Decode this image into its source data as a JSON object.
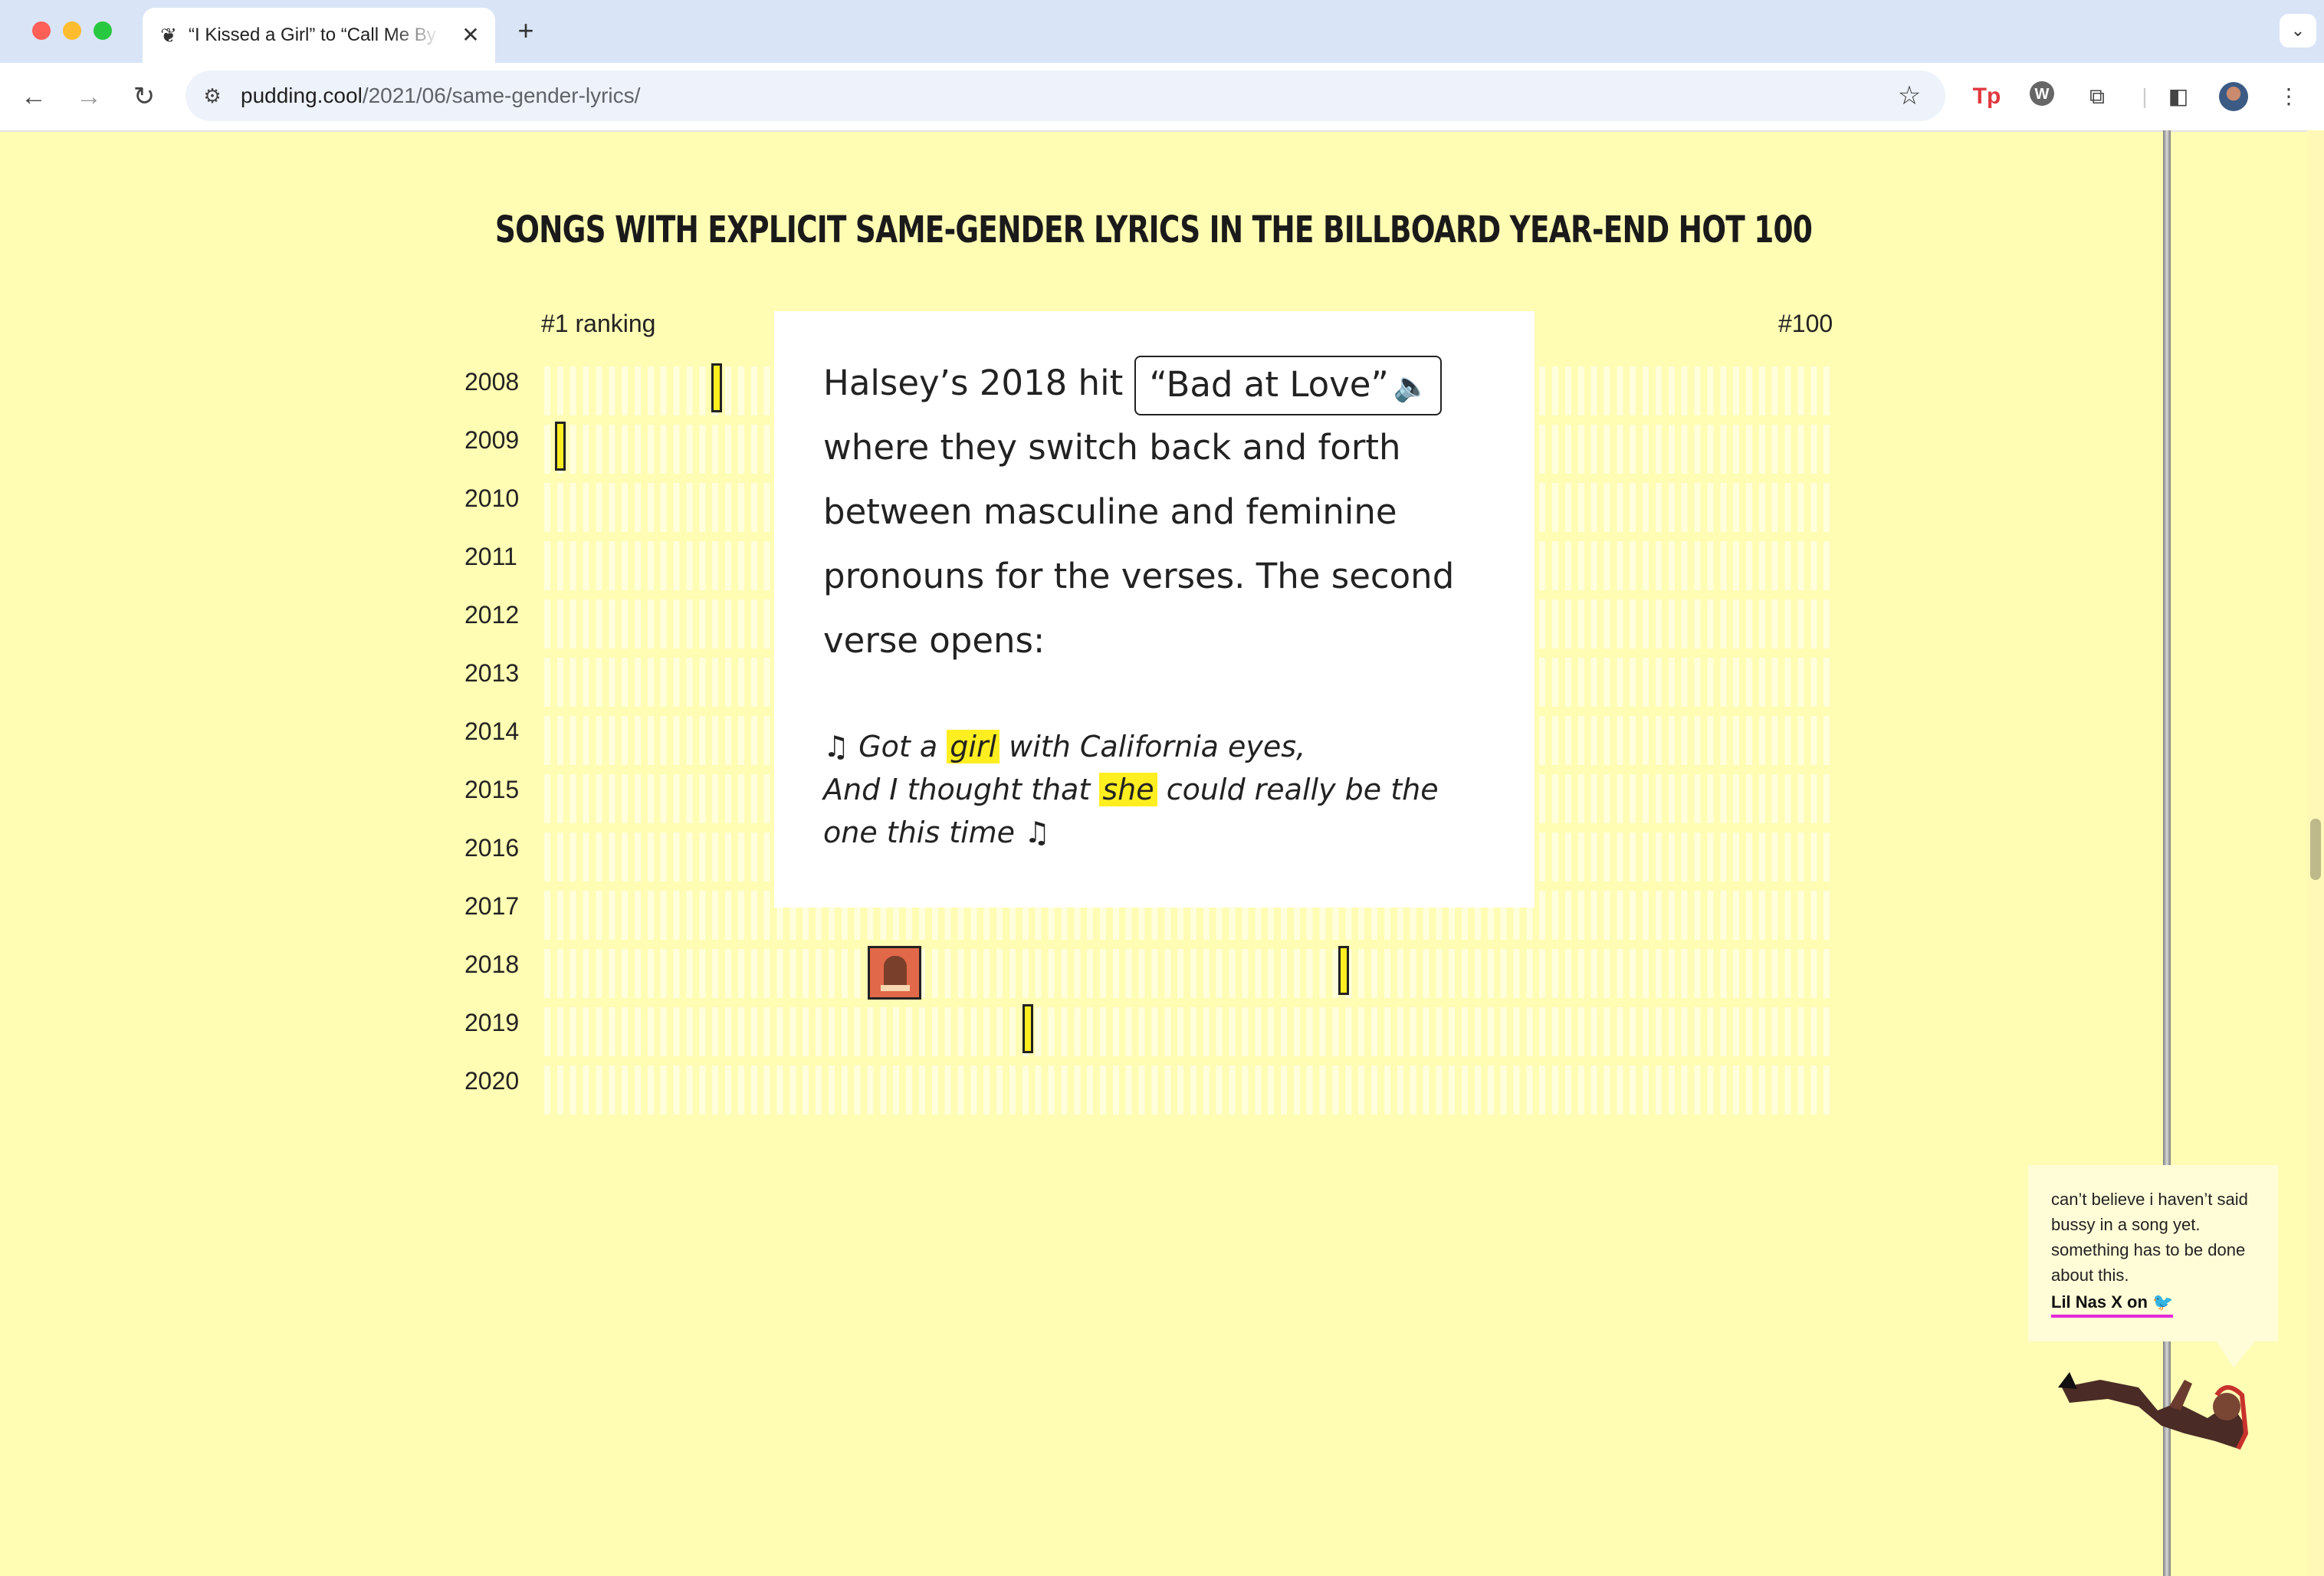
{
  "browser": {
    "tab_title": "“I Kissed a Girl” to “Call Me By Your Name”",
    "url_host": "pudding.cool",
    "url_path": "/2021/06/same-gender-lyrics/"
  },
  "viz": {
    "title": "SONGS WITH EXPLICIT SAME-GENDER LYRICS IN THE BILLBOARD YEAR-END HOT 100",
    "left_label": "#1 ranking",
    "right_label": "#100",
    "years": [
      "2008",
      "2009",
      "2010",
      "2011",
      "2012",
      "2013",
      "2014",
      "2015",
      "2016",
      "2017",
      "2018",
      "2019",
      "2020"
    ]
  },
  "card": {
    "intro": "Halsey’s 2018 hit",
    "song": "“Bad at Love”",
    "speaker_icon": "speaker-icon",
    "body": "where they switch back and forth between masculine and feminine pronouns for the verses. The second verse opens:",
    "lyric_1a": "♫ Got a",
    "lyric_1_hl": "girl",
    "lyric_1b": "with California eyes,",
    "lyric_2a": "And I thought that",
    "lyric_2_hl": "she",
    "lyric_2b": "could really be the one this time ♫"
  },
  "tweet": {
    "text": "can’t believe i haven’t said bussy in a song yet. something has to be done about this.",
    "link": "Lil Nas X on"
  },
  "colors": {
    "page_bg": "#fffcb4",
    "highlight": "#ffee20",
    "link_underline": "#e22bd9"
  }
}
